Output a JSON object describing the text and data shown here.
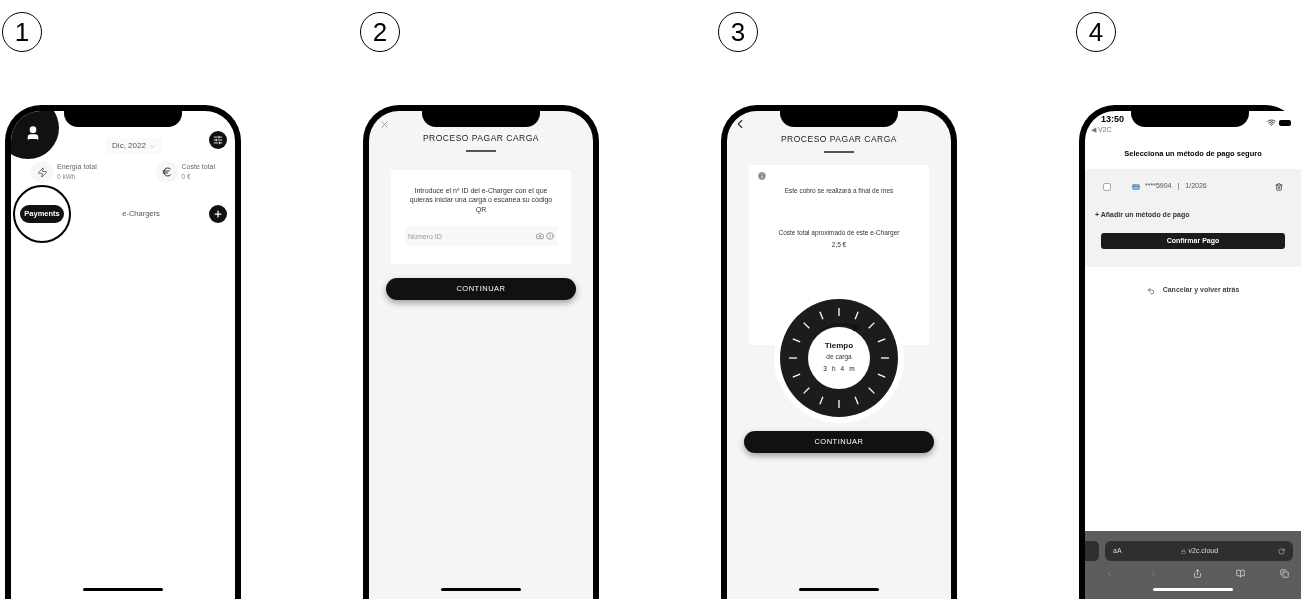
{
  "steps": [
    {
      "number": "1",
      "kind": "dashboard",
      "month": "Dic, 2022",
      "stats": [
        {
          "kind": "energy",
          "label": "Energía total",
          "value": "0 kWh"
        },
        {
          "kind": "cost",
          "label": "Coste total",
          "value": "0 €"
        }
      ],
      "tabs": [
        {
          "label": "Payments",
          "selected": true,
          "highlighted": true
        },
        {
          "label": "e-Chargers",
          "selected": false,
          "highlighted": false
        }
      ]
    },
    {
      "number": "2",
      "kind": "enter_id",
      "title": "PROCESO PAGAR CARGA",
      "instructions": "Introduce el nº ID del e-Charger con el que quieras iniciar una carga o escanea su código QR",
      "id_field": {
        "placeholder": "Número ID"
      },
      "button": "CONTINUAR"
    },
    {
      "number": "3",
      "kind": "charge_time",
      "title": "PROCESO PAGAR CARGA",
      "notice": "Este cobro se realizará a final de mes",
      "cost_label": "Coste total aproximado de este e-Charger",
      "cost": "2,5 €",
      "dial": {
        "title": "Tiempo",
        "subtitle": "de carga",
        "hours": "3",
        "hours_unit": "h",
        "minutes": "4",
        "minutes_unit": "m"
      },
      "button": "CONTINUAR"
    },
    {
      "number": "4",
      "kind": "payment",
      "time": "13:50",
      "back_app": "◀ V2C",
      "heading": "Selecciona un método de pago seguro",
      "cards": [
        {
          "checked": false,
          "number": "****5904",
          "separator": "|",
          "expiry": "1/2026"
        }
      ],
      "add_method": "+ Añadir un método de pago",
      "button": "Confirmar Pago",
      "cancel": "Cancelar y volver atrás",
      "browser": {
        "text_size": "aA",
        "url": "v2c.cloud"
      }
    }
  ]
}
